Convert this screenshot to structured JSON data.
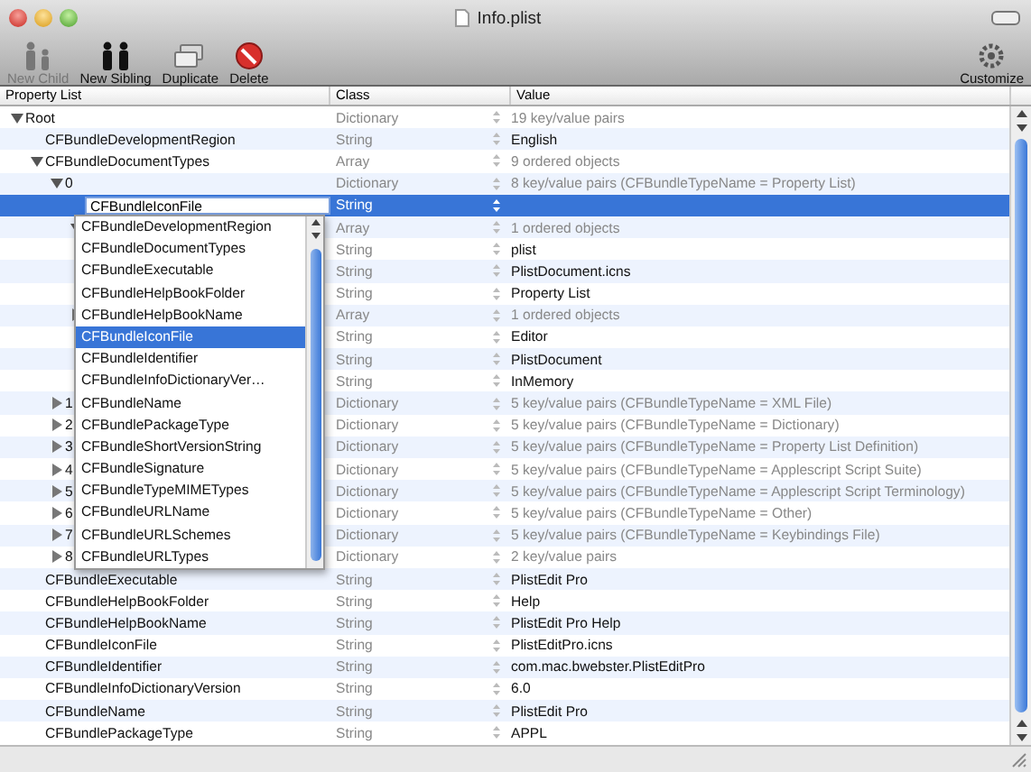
{
  "window": {
    "title": "Info.plist"
  },
  "toolbar": [
    {
      "label": "New Child",
      "kind": "child",
      "disabled": true
    },
    {
      "label": "New Sibling",
      "kind": "sibling",
      "disabled": false
    },
    {
      "label": "Duplicate",
      "kind": "duplicate",
      "disabled": false
    },
    {
      "label": "Delete",
      "kind": "delete",
      "disabled": false
    }
  ],
  "toolbar_right": {
    "label": "Customize",
    "kind": "customize",
    "disabled": false
  },
  "columns": [
    "Property List",
    "Class",
    "Value"
  ],
  "rows": [
    {
      "key": "Root",
      "class": "Dictionary",
      "value": "19 key/value pairs",
      "expanded": true,
      "selected": false,
      "children": [
        {
          "key": "CFBundleDevelopmentRegion",
          "class": "String",
          "value": "English",
          "selected": false
        },
        {
          "key": "CFBundleDocumentTypes",
          "class": "Array",
          "value": "9 ordered objects",
          "expanded": true,
          "selected": false,
          "children": [
            {
              "key": "0",
              "class": "Dictionary",
              "value": "8 key/value pairs (CFBundleTypeName = Property List)",
              "expanded": true,
              "selected": false,
              "children": [
                {
                  "key": "CFBundleIconFile",
                  "class": "String",
                  "selected": true,
                  "editing": true
                },
                {
                  "class": "Array",
                  "value": "1 ordered objects",
                  "expanded": true,
                  "selected": false,
                  "children": [
                    {
                      "class": "String",
                      "value": "plist",
                      "selected": false
                    }
                  ]
                },
                {
                  "class": "String",
                  "value": "PlistDocument.icns",
                  "selected": false
                },
                {
                  "class": "String",
                  "value": "Property List",
                  "selected": false
                },
                {
                  "class": "Array",
                  "value": "1 ordered objects",
                  "expanded": false,
                  "selected": false
                },
                {
                  "class": "String",
                  "value": "Editor",
                  "selected": false
                },
                {
                  "class": "String",
                  "value": "PlistDocument",
                  "selected": false
                },
                {
                  "class": "String",
                  "value": "InMemory",
                  "selected": false
                }
              ]
            },
            {
              "key": "1",
              "class": "Dictionary",
              "value": "5 key/value pairs (CFBundleTypeName = XML File)",
              "expanded": false,
              "selected": false
            },
            {
              "key": "2",
              "class": "Dictionary",
              "value": "5 key/value pairs (CFBundleTypeName = Dictionary)",
              "expanded": false,
              "selected": false
            },
            {
              "key": "3",
              "class": "Dictionary",
              "value": "5 key/value pairs (CFBundleTypeName = Property List Definition)",
              "expanded": false,
              "selected": false
            },
            {
              "key": "4",
              "class": "Dictionary",
              "value": "5 key/value pairs (CFBundleTypeName = Applescript Script Suite)",
              "expanded": false,
              "selected": false
            },
            {
              "key": "5",
              "class": "Dictionary",
              "value": "5 key/value pairs (CFBundleTypeName = Applescript Script Terminology)",
              "expanded": false,
              "selected": false
            },
            {
              "key": "6",
              "class": "Dictionary",
              "value": "5 key/value pairs (CFBundleTypeName = Other)",
              "expanded": false,
              "selected": false
            },
            {
              "key": "7",
              "class": "Dictionary",
              "value": "5 key/value pairs (CFBundleTypeName = Keybindings File)",
              "expanded": false,
              "selected": false
            },
            {
              "key": "8",
              "class": "Dictionary",
              "value": "2 key/value pairs",
              "expanded": false,
              "selected": false
            }
          ]
        },
        {
          "key": "CFBundleExecutable",
          "class": "String",
          "value": "PlistEdit Pro",
          "selected": false
        },
        {
          "key": "CFBundleHelpBookFolder",
          "class": "String",
          "value": "Help",
          "selected": false
        },
        {
          "key": "CFBundleHelpBookName",
          "class": "String",
          "value": "PlistEdit Pro Help",
          "selected": false
        },
        {
          "key": "CFBundleIconFile",
          "class": "String",
          "value": "PlistEditPro.icns",
          "selected": false
        },
        {
          "key": "CFBundleIdentifier",
          "class": "String",
          "value": "com.mac.bwebster.PlistEditPro",
          "selected": false
        },
        {
          "key": "CFBundleInfoDictionaryVersion",
          "class": "String",
          "value": "6.0",
          "selected": false
        },
        {
          "key": "CFBundleName",
          "class": "String",
          "value": "PlistEdit Pro",
          "selected": false
        },
        {
          "key": "CFBundlePackageType",
          "class": "String",
          "value": "APPL",
          "selected": false
        }
      ]
    }
  ],
  "completion": [
    {
      "label": "CFBundleDevelopmentRegion",
      "selected": false
    },
    {
      "label": "CFBundleDocumentTypes",
      "selected": false
    },
    {
      "label": "CFBundleExecutable",
      "selected": false
    },
    {
      "label": "CFBundleHelpBookFolder",
      "selected": false
    },
    {
      "label": "CFBundleHelpBookName",
      "selected": false
    },
    {
      "label": "CFBundleIconFile",
      "selected": true
    },
    {
      "label": "CFBundleIdentifier",
      "selected": false
    },
    {
      "label": "CFBundleInfoDictionaryVer…",
      "selected": false
    },
    {
      "label": "CFBundleName",
      "selected": false
    },
    {
      "label": "CFBundlePackageType",
      "selected": false
    },
    {
      "label": "CFBundleShortVersionString",
      "selected": false
    },
    {
      "label": "CFBundleSignature",
      "selected": false
    },
    {
      "label": "CFBundleTypeMIMETypes",
      "selected": false
    },
    {
      "label": "CFBundleURLName",
      "selected": false
    },
    {
      "label": "CFBundleURLSchemes",
      "selected": false
    },
    {
      "label": "CFBundleURLTypes",
      "selected": false
    }
  ]
}
